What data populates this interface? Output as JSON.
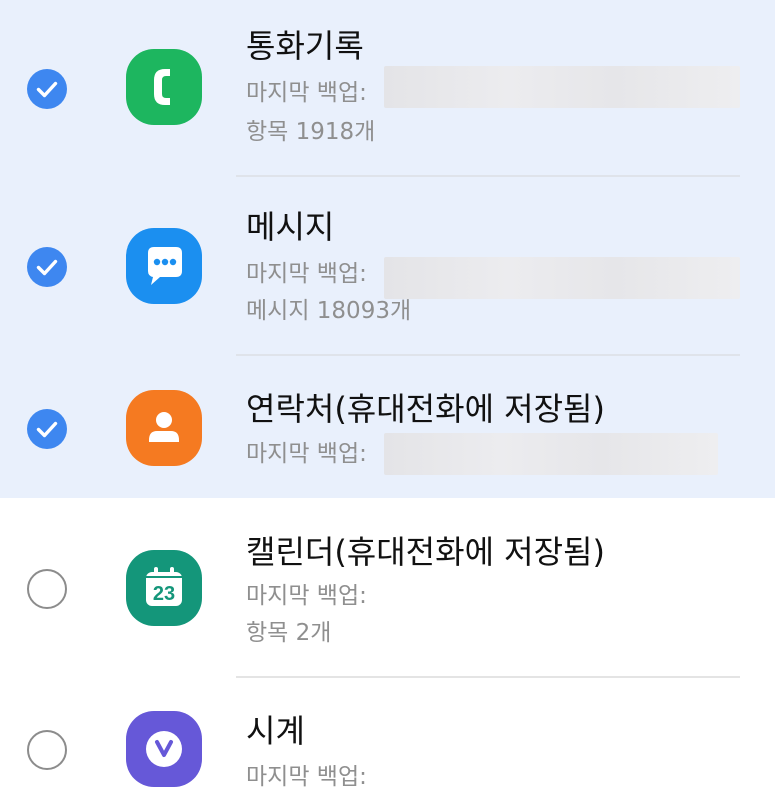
{
  "items": [
    {
      "title": "통화기록",
      "last_backup_label": "마지막 백업:",
      "detail": "항목 1918개",
      "checked": true,
      "icon": "phone-icon",
      "icon_color": "#1db65f"
    },
    {
      "title": "메시지",
      "last_backup_label": "마지막 백업:",
      "detail": "메시지 18093개",
      "checked": true,
      "icon": "message-icon",
      "icon_color": "#1b8ff0"
    },
    {
      "title": "연락처(휴대전화에 저장됨)",
      "last_backup_label": "마지막 백업:",
      "checked": true,
      "icon": "contacts-icon",
      "icon_color": "#f57a21"
    },
    {
      "title": "캘린더(휴대전화에 저장됨)",
      "last_backup_label": "마지막 백업:",
      "detail": "항목 2개",
      "checked": false,
      "icon": "calendar-icon",
      "icon_color": "#14967a",
      "icon_text": "23"
    },
    {
      "title": "시계",
      "last_backup_label": "마지막 백업:",
      "checked": false,
      "icon": "clock-icon",
      "icon_color": "#6658d8"
    }
  ],
  "colors": {
    "selected_bg": "#e9f0fc",
    "checkbox_on": "#3e87f0",
    "divider": "#dfe3ea"
  }
}
